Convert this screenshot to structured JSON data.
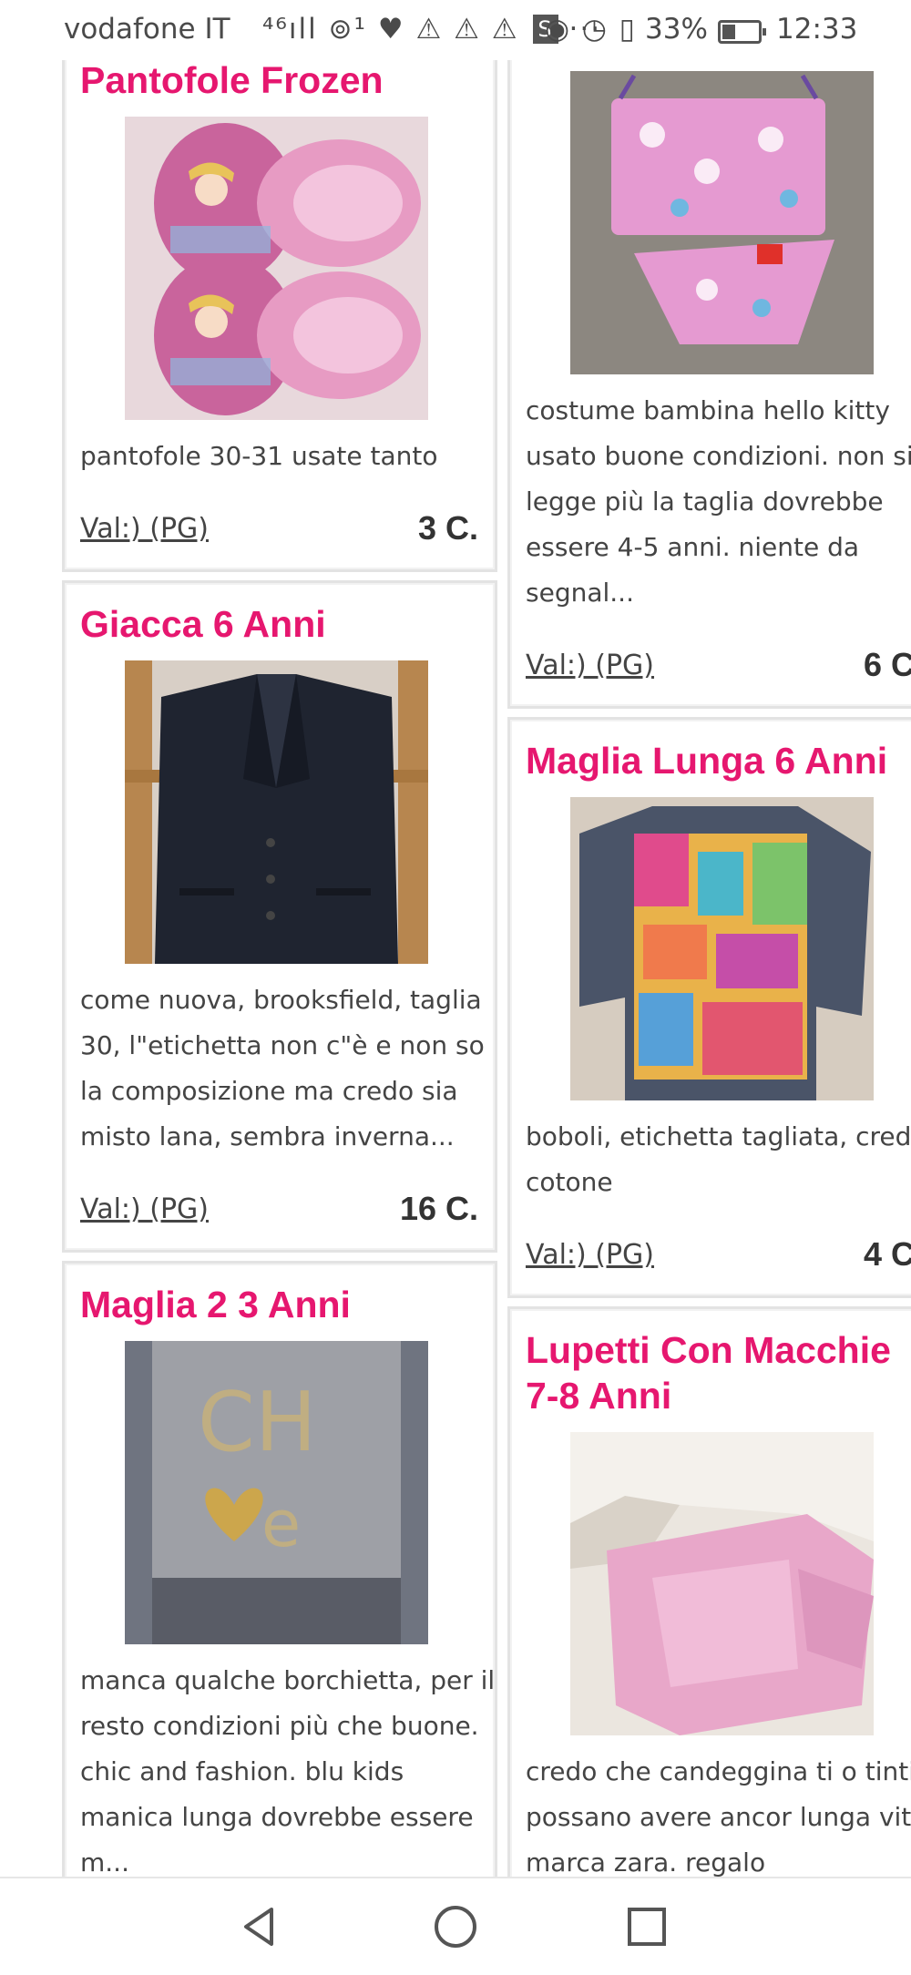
{
  "status_bar": {
    "carrier": "vodafone IT",
    "icons_left": "⁴⁶ıll ⊚¹ ♥ ⚠ ⚠ ⚠",
    "badge": "S",
    "more": "···",
    "icons_right": "◉ ◷ ▯",
    "battery_percent": "33%",
    "battery_level": 0.33,
    "time": "12:33"
  },
  "listings": [
    {
      "title": "Pantofole Frozen",
      "image": "pink-frozen-slippers",
      "description": [
        "pantofole 30-31 usate tanto"
      ],
      "seller": "Val:) (PG)",
      "price": "3 C."
    },
    {
      "title": "",
      "image": "hello-kitty-swimsuit",
      "description": [
        "costume bambina hello kitty",
        "usato buone condizioni. non si",
        "legge più la taglia dovrebbe",
        "essere 4-5 anni. niente da",
        "segnal..."
      ],
      "seller": "Val:) (PG)",
      "price": "6 C"
    },
    {
      "title": "Giacca 6 Anni",
      "image": "navy-blazer",
      "description": [
        "come nuova, brooksfield, taglia",
        "30, l\"etichetta non c\"è e non so",
        "la composizione ma credo sia",
        "misto lana, sembra inverna..."
      ],
      "seller": "Val:) (PG)",
      "price": "16 C."
    },
    {
      "title": "Maglia Lunga 6 Anni",
      "image": "printed-long-sleeve-top",
      "description": [
        "boboli, etichetta tagliata, credo",
        "cotone"
      ],
      "seller": "Val:) (PG)",
      "price": "4 C"
    },
    {
      "title": "Maglia 2 3 Anni",
      "image": "grey-studded-dress",
      "description": [
        "manca qualche borchietta, per il",
        "resto condizioni più che buone.",
        "chic and fashion. blu kids",
        "manica lunga dovrebbe essere",
        "m..."
      ],
      "seller": "",
      "price": ""
    },
    {
      "title_lines": [
        "Lupetti Con Macchie",
        "7-8 Anni"
      ],
      "image": "pink-turtleneck",
      "description": [
        "credo che candeggina ti o tinti",
        "possano avere ancor lunga vita",
        "marca zara. regalo"
      ],
      "seller": "",
      "price": ""
    }
  ],
  "nav_bar": {
    "back": "back-icon",
    "home": "home-icon",
    "recents": "recents-icon"
  },
  "colors": {
    "title": "#e6176f",
    "card_border": "#e3e3e3"
  }
}
